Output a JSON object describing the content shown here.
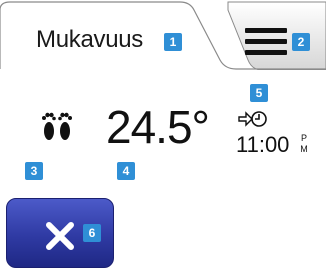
{
  "header": {
    "tab_title": "Mukavuus",
    "tab_badge": "1",
    "menu_badge": "2",
    "menu_icon": "hamburger-menu-icon"
  },
  "status": {
    "mode_icon": "feet-comfort-icon",
    "mode_badge": "3",
    "temperature": "24.5°",
    "temperature_badge": "4",
    "schedule_icon": "schedule-arrow-clock-icon",
    "schedule_badge": "5",
    "time": "11:00",
    "ampm_top": "P",
    "ampm_bottom": "M"
  },
  "cancel": {
    "icon": "close-x-icon",
    "badge": "6"
  },
  "colors": {
    "badge": "#2f8fd6",
    "button": "#2f3aa3",
    "tab_border": "#8a8a8a"
  }
}
